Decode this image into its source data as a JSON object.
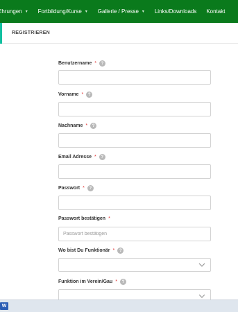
{
  "nav": {
    "items": [
      {
        "label": "Ehrungen",
        "has_dropdown": true
      },
      {
        "label": "Fortbildung/Kurse",
        "has_dropdown": true
      },
      {
        "label": "Gallerie / Presse",
        "has_dropdown": true
      },
      {
        "label": "Links/Downloads",
        "has_dropdown": false
      },
      {
        "label": "Kontakt",
        "has_dropdown": false
      }
    ],
    "caret": "▼"
  },
  "page": {
    "title": "REGISTRIEREN"
  },
  "form": {
    "required_mark": "*",
    "help_icon": "?",
    "fields": [
      {
        "label": "Benutzername",
        "value": "",
        "placeholder": ""
      },
      {
        "label": "Vorname",
        "value": "",
        "placeholder": ""
      },
      {
        "label": "Nachname",
        "value": "",
        "placeholder": ""
      },
      {
        "label": "Email Adresse",
        "value": "",
        "placeholder": ""
      },
      {
        "label": "Passwort",
        "value": "",
        "placeholder": ""
      },
      {
        "label": "Passwort bestätigen",
        "value": "",
        "placeholder": "Passwort bestätigen"
      },
      {
        "label": "Wo bist Du Funktionär",
        "selected": ""
      },
      {
        "label": "Funktion im Verein/Gau",
        "selected": ""
      }
    ]
  },
  "taskbar": {
    "word_icon_label": "W"
  },
  "colors": {
    "nav_background": "#0a7a1c",
    "accent": "#12c0a0",
    "required": "#e03030",
    "help_icon": "#b9b9b9"
  }
}
